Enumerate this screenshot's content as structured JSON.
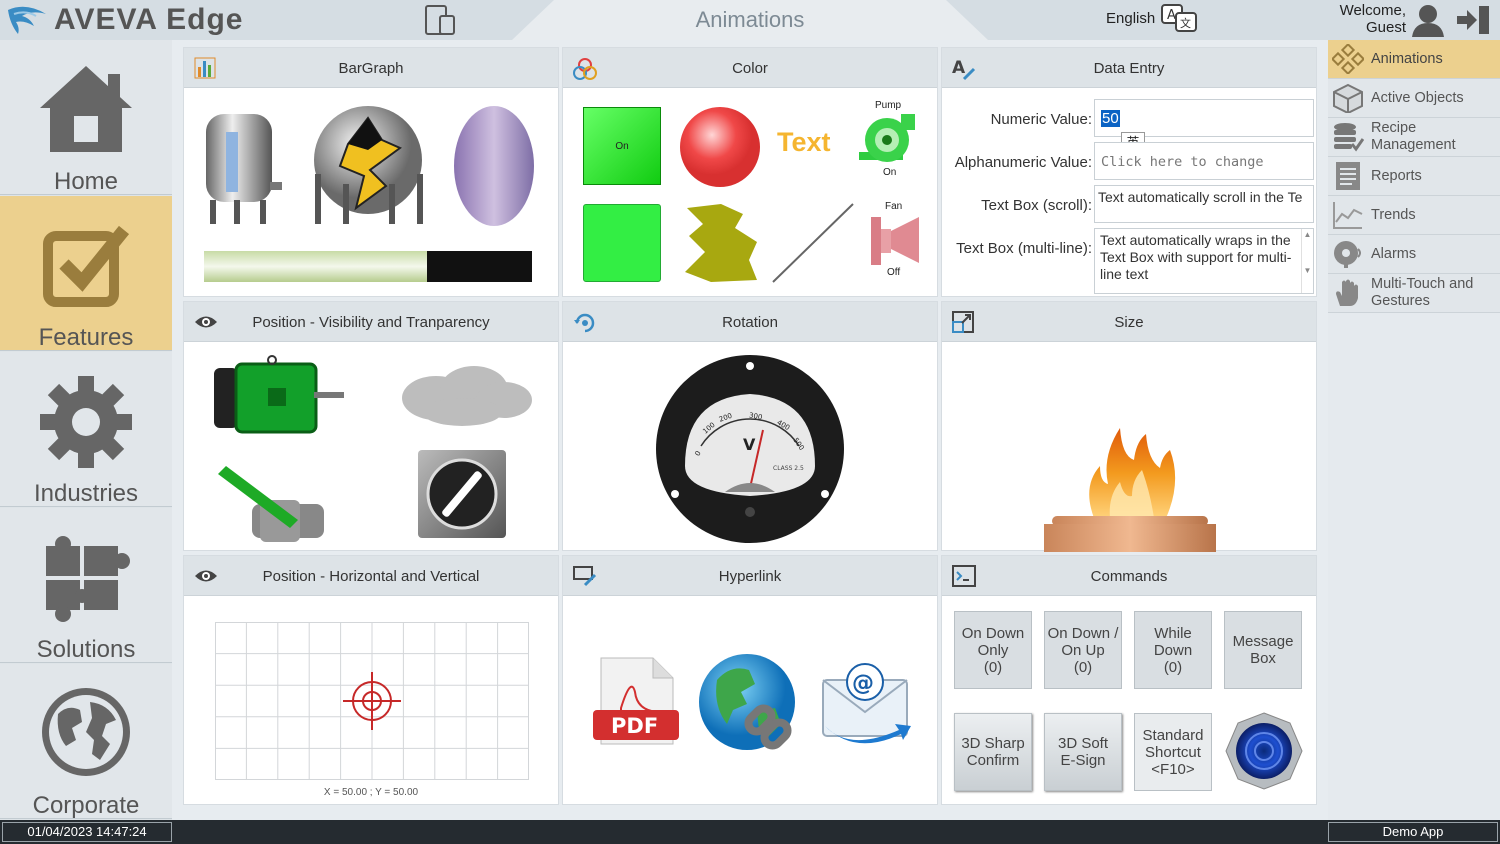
{
  "header": {
    "logo_text": "AVEVA Edge",
    "title": "Animations",
    "language": "English",
    "welcome_line1": "Welcome,",
    "welcome_line2": "Guest"
  },
  "left_nav": [
    {
      "label": "Home",
      "active": false
    },
    {
      "label": "Features",
      "active": true
    },
    {
      "label": "Industries",
      "active": false
    },
    {
      "label": "Solutions",
      "active": false
    },
    {
      "label": "Corporate",
      "active": false
    }
  ],
  "panels": {
    "bargraph": {
      "title": "BarGraph",
      "bar_fill_percent": 68
    },
    "color": {
      "title": "Color",
      "on_label": "On",
      "text_label": "Text",
      "pump_label": "Pump",
      "pump_state": "On",
      "fan_label": "Fan",
      "fan_state": "Off"
    },
    "data_entry": {
      "title": "Data Entry",
      "numeric_label": "Numeric Value:",
      "numeric_value": "50",
      "ime_char": "英",
      "alpha_label": "Alphanumeric Value:",
      "alpha_placeholder": "Click here to change",
      "scroll_label": "Text Box (scroll):",
      "scroll_text": "Text automatically scroll in the Te",
      "multiline_label": "Text Box (multi-line):",
      "multiline_text": "Text automatically wraps in the Text Box with support for multi-line text"
    },
    "visibility": {
      "title": "Position - Visibility and Tranparency"
    },
    "rotation": {
      "title": "Rotation",
      "gauge_ticks": [
        "0",
        "100",
        "200",
        "300",
        "400",
        "500"
      ],
      "gauge_unit": "V",
      "gauge_class": "CLASS 2.5"
    },
    "size": {
      "title": "Size"
    },
    "position": {
      "title": "Position - Horizontal and Vertical",
      "readout": "X = 50.00 ; Y = 50.00"
    },
    "hyperlink": {
      "title": "Hyperlink",
      "pdf_label": "PDF"
    },
    "commands": {
      "title": "Commands",
      "buttons": [
        {
          "line1": "On Down",
          "line2": "Only",
          "line3": "(0)"
        },
        {
          "line1": "On Down /",
          "line2": "On Up",
          "line3": "(0)"
        },
        {
          "line1": "While",
          "line2": "Down",
          "line3": "(0)"
        },
        {
          "line1": "Message",
          "line2": "Box",
          "line3": ""
        },
        {
          "line1": "3D Sharp",
          "line2": "Confirm",
          "line3": ""
        },
        {
          "line1": "3D Soft",
          "line2": "E-Sign",
          "line3": ""
        },
        {
          "line1": "Standard",
          "line2": "Shortcut",
          "line3": "<F10>"
        }
      ]
    }
  },
  "right_nav": [
    {
      "label": "Animations",
      "active": true
    },
    {
      "label": "Active Objects",
      "active": false
    },
    {
      "label": "Recipe Management",
      "active": false
    },
    {
      "label": "Reports",
      "active": false
    },
    {
      "label": "Trends",
      "active": false
    },
    {
      "label": "Alarms",
      "active": false
    },
    {
      "label": "Multi-Touch and Gestures",
      "active": false
    }
  ],
  "status": {
    "datetime": "01/04/2023 14:47:24",
    "app_name": "Demo App"
  },
  "colors": {
    "accent": "#ecd08e",
    "header_bg": "#d5dde3",
    "status_bg": "#252b30",
    "green": "#22dd22"
  }
}
